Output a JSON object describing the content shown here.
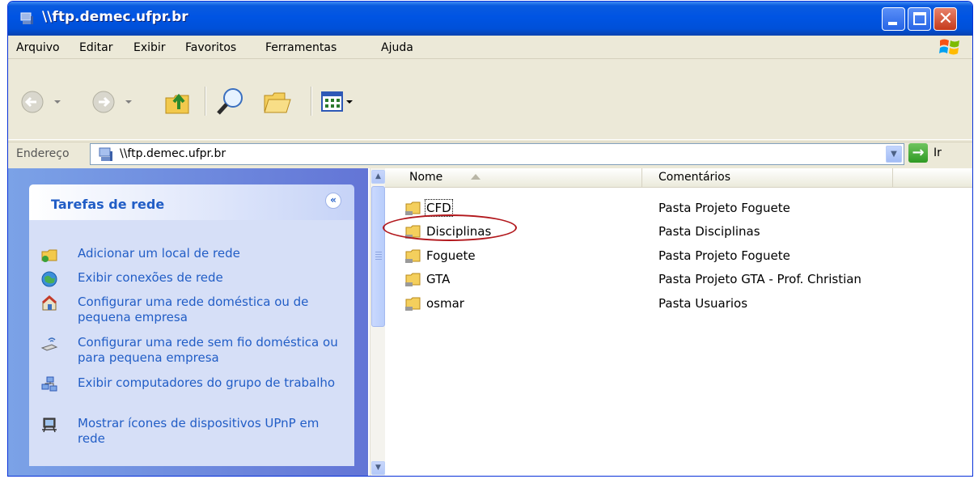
{
  "window": {
    "title": "\\\\ftp.demec.ufpr.br",
    "controls": [
      "minimize-icon",
      "maximize-icon",
      "close-icon"
    ]
  },
  "menu": {
    "items": [
      {
        "label": "Arquivo"
      },
      {
        "label": "Editar"
      },
      {
        "label": "Exibir"
      },
      {
        "label": "Favoritos"
      },
      {
        "label": "Ferramentas"
      },
      {
        "label": "Ajuda"
      }
    ]
  },
  "toolbar": {
    "icons": [
      "back-icon",
      "forward-icon",
      "up-folder-icon",
      "search-icon",
      "folders-icon",
      "views-icon"
    ]
  },
  "address": {
    "label": "Endereço",
    "value": "\\\\ftp.demec.ufpr.br",
    "go_label": "Ir"
  },
  "tasks": {
    "title": "Tarefas de rede",
    "items": [
      {
        "label": "Adicionar um local de rede",
        "icon": "add-network-place-icon"
      },
      {
        "label": "Exibir conexões de rede",
        "icon": "network-connections-icon"
      },
      {
        "label": "Configurar uma rede doméstica ou de pequena empresa",
        "icon": "home-network-icon"
      },
      {
        "label": "Configurar uma rede sem fio doméstica ou para pequena empresa",
        "icon": "wireless-network-icon"
      },
      {
        "label": "Exibir computadores do grupo de trabalho",
        "icon": "workgroup-computers-icon"
      },
      {
        "label": "Mostrar ícones de dispositivos UPnP em rede",
        "icon": "upnp-device-icon"
      }
    ]
  },
  "files": {
    "columns": [
      "Nome",
      "Comentários"
    ],
    "rows": [
      {
        "name": "CFD",
        "comment": "Pasta Projeto Foguete"
      },
      {
        "name": "Disciplinas",
        "comment": "Pasta Disciplinas"
      },
      {
        "name": "Foguete",
        "comment": "Pasta Projeto Foguete"
      },
      {
        "name": "GTA",
        "comment": "Pasta Projeto GTA - Prof. Christian"
      },
      {
        "name": "osmar",
        "comment": "Pasta Usuarios"
      }
    ]
  },
  "colors": {
    "titlebar": "#0054e3",
    "task_link": "#215dc6",
    "highlight_circle": "#b2171c"
  }
}
